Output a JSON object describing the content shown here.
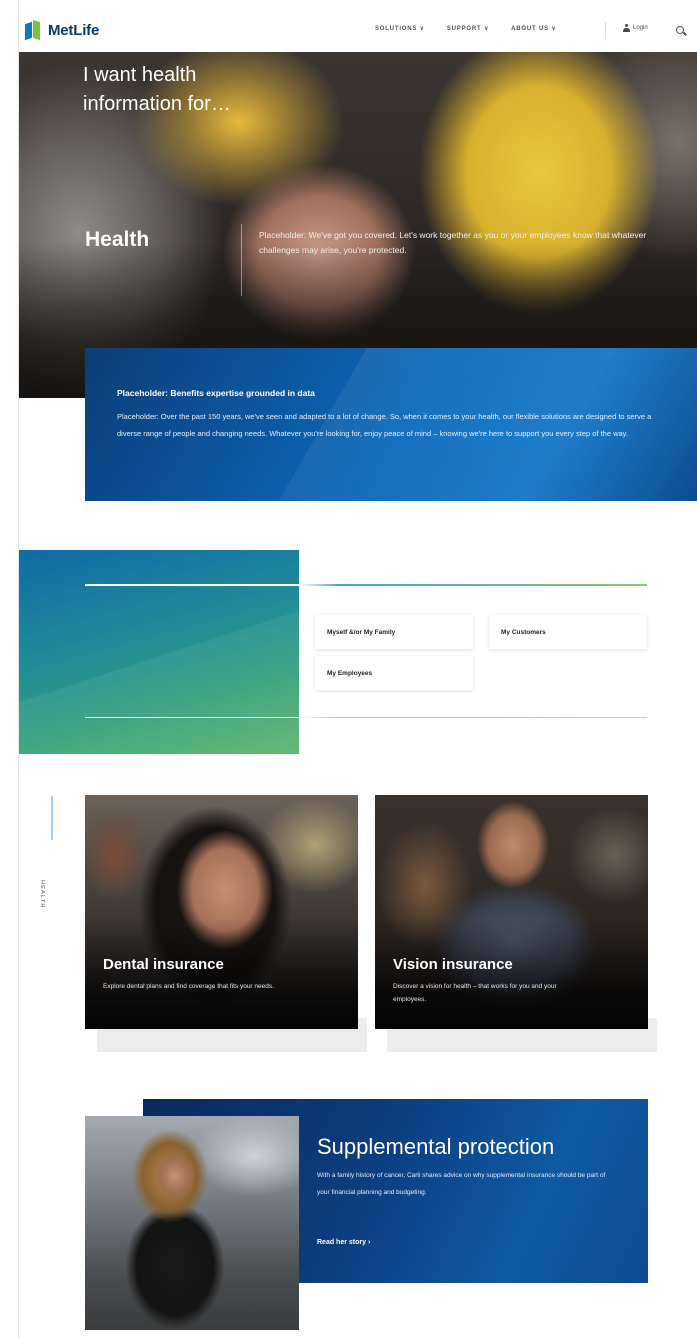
{
  "header": {
    "logo_text": "MetLife",
    "nav": [
      "SOLUTIONS ∨",
      "SUPPORT ∨",
      "ABOUT US ∨"
    ],
    "login_label": "Login"
  },
  "hero": {
    "title": "Health",
    "text": "Placeholder: We've got you covered. Let's work together as you or your employees know that whatever challenges may arise, you're protected."
  },
  "info_panel": {
    "heading": "Placeholder: Benefits expertise grounded in data",
    "body": "Placeholder: Over the past 150 years, we've seen and adapted to a lot of change. So, when it comes to your health, our flexible solutions are designed to serve a diverse range of people and changing needs. Whatever you're looking for, enjoy peace of mind – knowing we're here to support you every step of the way."
  },
  "want": {
    "title": "I want health information for…",
    "options": [
      "Myself &/or My Family",
      "My Customers",
      "My Employees"
    ]
  },
  "side_label": "HEALTH",
  "cards": [
    {
      "title": "Dental insurance",
      "desc": "Explore dental plans and find coverage that fits your needs."
    },
    {
      "title": "Vision insurance",
      "desc": "Discover a vision for health – that works for you and your employees."
    }
  ],
  "supplemental": {
    "title": "Supplemental protection",
    "body": "With a family history of cancer, Carli shares advice on why supplemental insurance should be part of your financial planning and budgeting.",
    "link": "Read her story ›"
  }
}
